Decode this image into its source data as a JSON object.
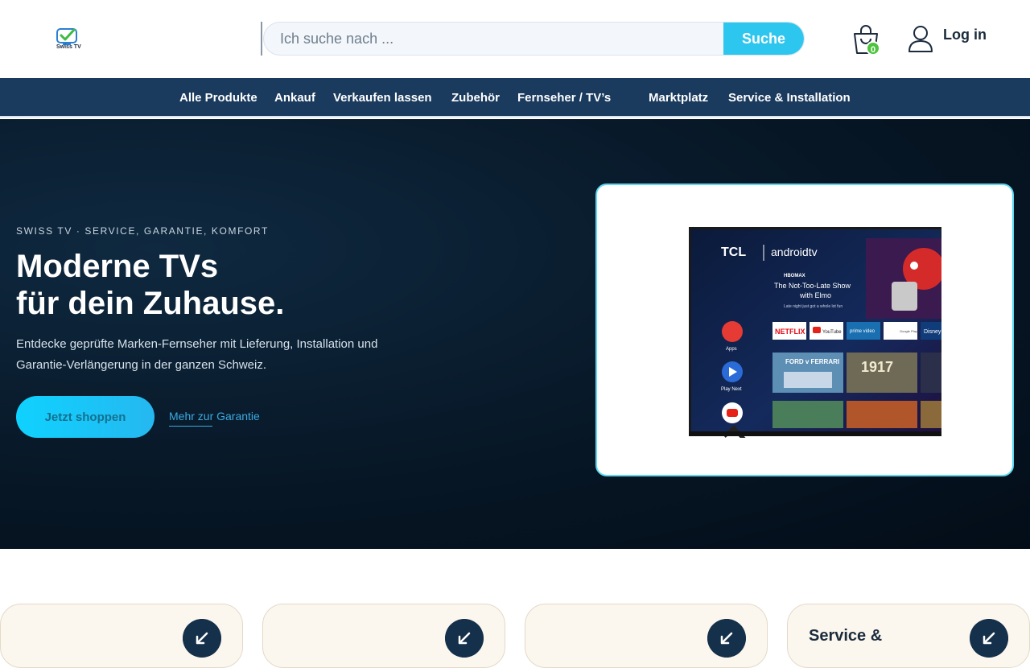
{
  "header": {
    "logo_text": "Swiss TV",
    "search_placeholder": "Ich suche nach ...",
    "search_button": "Suche",
    "cart_count": "0",
    "login_label": "Log in"
  },
  "nav": {
    "items": [
      "Alle Produkte",
      "Ankauf",
      "Verkaufen lassen",
      "Zubehör",
      "Fernseher / TV’s",
      "Marktplatz",
      "Service & Installation"
    ]
  },
  "hero": {
    "eyebrow": "SWISS TV · SERVICE, GARANTIE, KOMFORT",
    "title_line1": "Moderne TVs",
    "title_line2": "für dein Zuhause.",
    "description": "Entdecke geprüfte Marken-Fernseher mit Lieferung, Installation und Garantie-Verlängerung in der ganzen Schweiz.",
    "cta_label": "Jetzt shoppen",
    "link_label": "Mehr zur Garantie"
  },
  "tv_screen": {
    "brand": "TCL",
    "platform": "androidtv",
    "provider": "HBOMAX",
    "show_title_1": "The Not-Too-Late Show",
    "show_title_2": "with Elmo",
    "show_sub": "Late night just got a whole lot fun",
    "side_apps": "Apps",
    "side_play_next": "Play Next",
    "app_netflix": "NETFLIX",
    "app_youtube": "YouTube",
    "app_prime": "prime video",
    "app_gplay": "Google Play",
    "app_disney": "Disney",
    "movie1": "FORD v FERRARI",
    "movie2": "1917"
  },
  "features": [
    {
      "title": ""
    },
    {
      "title": ""
    },
    {
      "title": ""
    },
    {
      "title": "Service &"
    }
  ],
  "colors": {
    "accent": "#2cc6ef",
    "nav_bg": "#1a3a5e",
    "hero_bg": "#071726",
    "badge": "#4cc43d",
    "dark_button": "#15304a"
  }
}
